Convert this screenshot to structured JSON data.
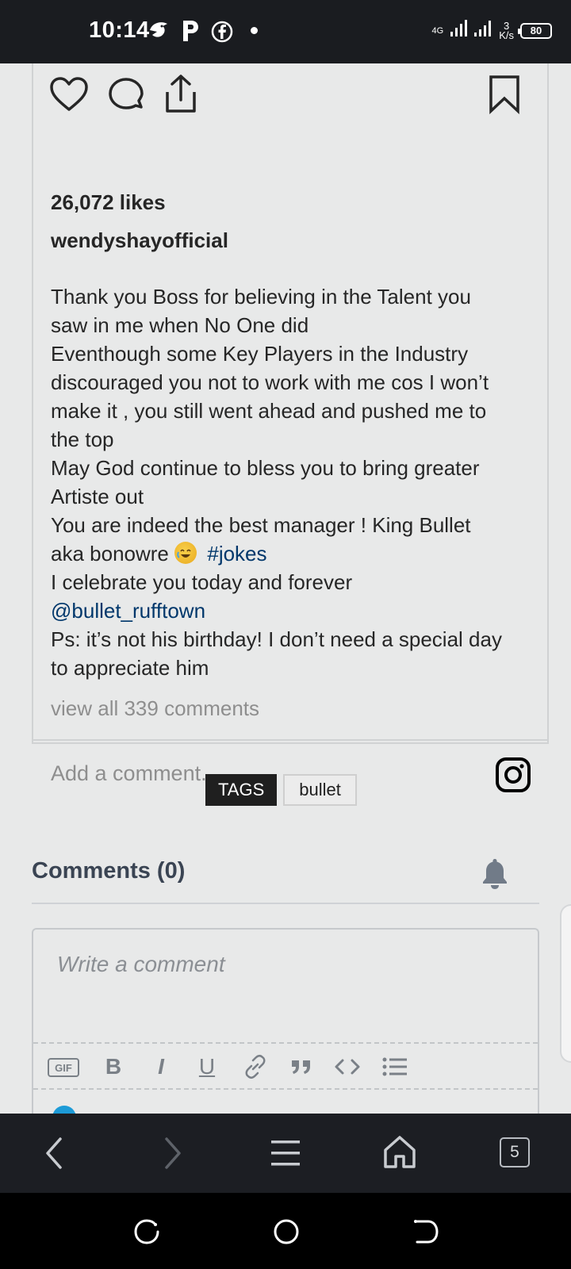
{
  "status_bar": {
    "time": "10:14",
    "network_type": "4G",
    "speed_value": "3",
    "speed_unit": "K/s",
    "battery": "80",
    "icons": [
      "hummingbird-icon",
      "parking-p-icon",
      "facebook-icon",
      "notification-dot"
    ]
  },
  "instagram_post": {
    "likes": "26,072 likes",
    "username": "wendyshayofficial",
    "caption_lines": [
      "Thank you Boss for believing in the Talent you",
      "saw in me when No One did",
      "Eventhough some Key Players in the Industry",
      "discouraged you not to work with me cos I won’t",
      "make it , you still went ahead and pushed me to",
      "the top",
      "May God continue to bless you to bring greater",
      "Artiste out",
      "You are indeed the best manager ! King Bullet"
    ],
    "caption_aka": "aka bonowre",
    "hashtag": "#jokes",
    "caption_celebrate": "I celebrate you today and forever",
    "mention": "@bullet_rufftown",
    "caption_ps_1": "Ps: it’s not his birthday! I don’t need a special day",
    "caption_ps_2": "to appreciate him",
    "view_comments": "view all 339 comments",
    "add_comment_placeholder": "Add a comment...",
    "icons": [
      "heart-icon",
      "comment-icon",
      "share-icon",
      "bookmark-icon",
      "instagram-logo-icon"
    ],
    "link_color": "#00376b"
  },
  "tags": {
    "label": "TAGS",
    "items": [
      "bullet"
    ]
  },
  "comments": {
    "title": "Comments (0)",
    "editor_placeholder": "Write a comment",
    "toolbar": {
      "gif": "GIF",
      "bold": "B",
      "italic": "I",
      "underline": "U"
    }
  },
  "browser_bar": {
    "tab_count": "5"
  }
}
